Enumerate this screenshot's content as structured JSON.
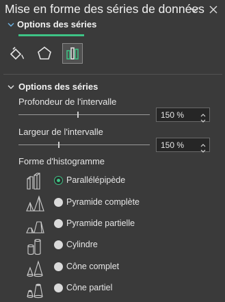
{
  "pane": {
    "title": "Mise en forme des séries de données",
    "subtab": "Options des séries"
  },
  "category_icons": [
    "fill-line-icon",
    "effects-pentagon-icon",
    "series-options-bars-icon"
  ],
  "section": {
    "title": "Options des séries"
  },
  "depth": {
    "label": "Profondeur de l'intervalle",
    "value": "150 %",
    "slider_fraction": 0.45
  },
  "width": {
    "label": "Largeur de l'intervalle",
    "value": "150 %",
    "slider_fraction": 0.3
  },
  "shape": {
    "label": "Forme d'histogramme",
    "options": [
      {
        "label": "Parallélépipède",
        "checked": true
      },
      {
        "label": "Pyramide complète",
        "checked": false
      },
      {
        "label": "Pyramide partielle",
        "checked": false
      },
      {
        "label": "Cylindre",
        "checked": false
      },
      {
        "label": "Cône complet",
        "checked": false
      },
      {
        "label": "Cône partiel",
        "checked": false
      }
    ]
  },
  "colors": {
    "accent": "#3ec486",
    "background": "#3a3a3a"
  }
}
